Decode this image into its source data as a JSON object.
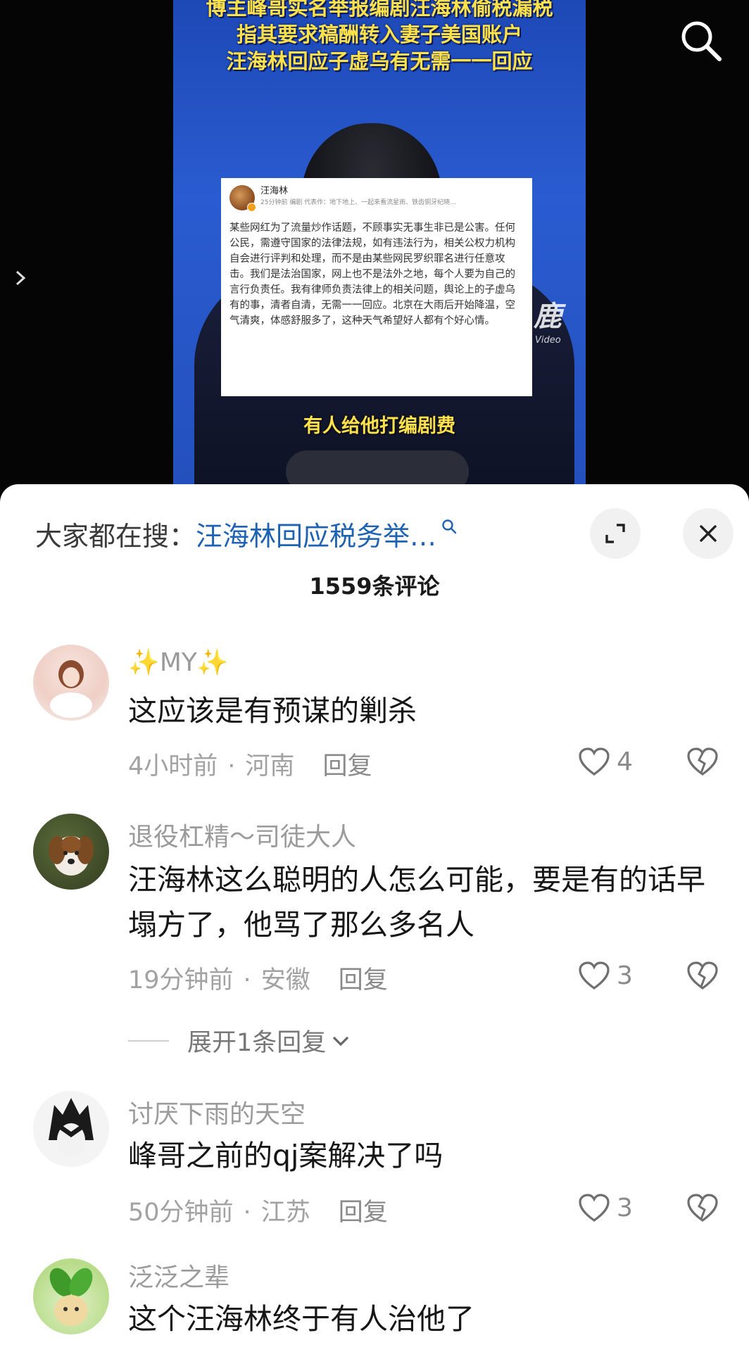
{
  "video": {
    "headline_lines": [
      "博主峰哥实名举报编剧汪海林偷税漏税",
      "指其要求稿酬转入妻子美国账户",
      "汪海林回应子虚乌有无需一一回应"
    ],
    "post": {
      "author": "汪海林",
      "time_meta": "25分钟前 编剧 代表作：地下地上、一起来看流星雨、铁齿铜牙纪晓…",
      "body": "某些网红为了流量炒作话题，不顾事实无事生非已是公害。任何公民，需遵守国家的法律法规，如有违法行为，相关公权力机构自会进行评判和处理，而不是由某些网民罗织罪名进行任意攻击。我们是法治国家，网上也不是法外之地，每个人要为自己的言行负责任。我有律师负责法律上的相关问题，舆论上的子虚乌有的事，清者自清，无需一一回应。北京在大雨后开始降温，空气清爽，体感舒服多了，这种天气希望好人都有个好心情。"
    },
    "caption": "有人给他打编剧费",
    "watermark": "鹿",
    "watermark_sub": "Video"
  },
  "sheet": {
    "search_prefix": "大家都在搜：",
    "search_link": "汪海林回应税务举…",
    "comment_count": "1559条评论",
    "comments": [
      {
        "name": "✨MY✨",
        "text": "这应该是有预谋的剿杀",
        "time": "4小时前",
        "location": "河南",
        "reply": "回复",
        "likes": "4"
      },
      {
        "name": "退役杠精～司徒大人",
        "text": "汪海林这么聪明的人怎么可能，要是有的话早塌方了，他骂了那么多名人",
        "time": "19分钟前",
        "location": "安徽",
        "reply": "回复",
        "likes": "3"
      },
      {
        "name": "讨厌下雨的天空",
        "text": "峰哥之前的qj案解决了吗",
        "time": "50分钟前",
        "location": "江苏",
        "reply": "回复",
        "likes": "3"
      },
      {
        "name": "泛泛之辈",
        "text": "这个汪海林终于有人治他了"
      }
    ],
    "expand_replies": "展开1条回复",
    "meta_separator": "·"
  },
  "colors": {
    "accent_link": "#1e62b4",
    "headline_yellow": "#ffe14a",
    "video_blue": "#2a5bd0"
  }
}
